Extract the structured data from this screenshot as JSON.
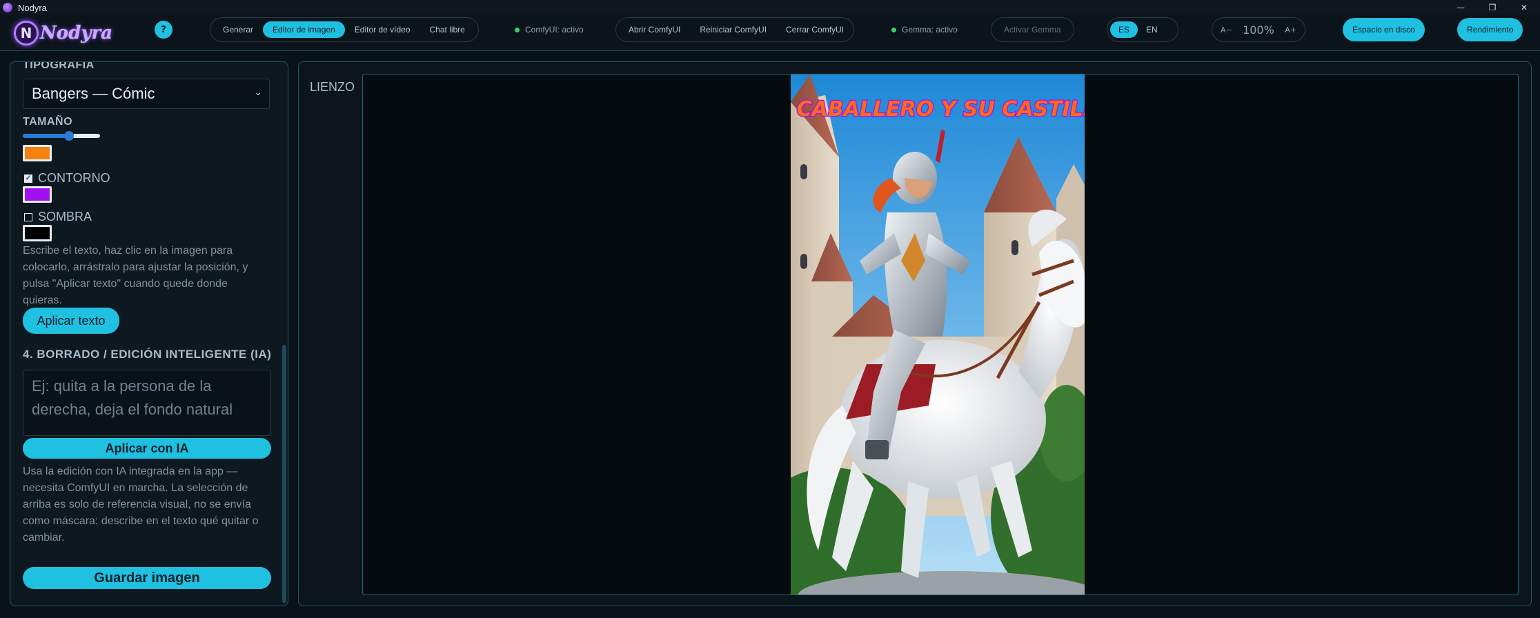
{
  "window": {
    "title": "Nodyra",
    "controls": [
      "—",
      "❐",
      "✕"
    ]
  },
  "header": {
    "logo_text": "Nodyra",
    "help_label": "?",
    "tabs": [
      {
        "label": "Generar",
        "active": false
      },
      {
        "label": "Editor de imagen",
        "active": true
      },
      {
        "label": "Editor de vídeo",
        "active": false
      },
      {
        "label": "Chat libre",
        "active": false
      }
    ],
    "comfy_status": "ComfyUI: activo",
    "comfy_actions": [
      "Abrir ComfyUI",
      "Reiniciar ComfyUI",
      "Cerrar ComfyUI"
    ],
    "gemma_status": "Gemma: activo",
    "activate_gemma": "Activar Gemma",
    "languages": [
      {
        "label": "ES",
        "active": true
      },
      {
        "label": "EN",
        "active": false
      }
    ],
    "zoom": {
      "minus": "A−",
      "value": "100%",
      "plus": "A+"
    },
    "disk_space": "Espacio en disco",
    "performance": "Rendimiento"
  },
  "left_panel": {
    "typography_label": "TIPOGRAFÍA",
    "font_select": "Bangers — Cómic",
    "size_label": "TAMAÑO",
    "size_value": 0.6,
    "fill_color": "#f4820f",
    "outline_label": "CONTORNO",
    "outline_checked": true,
    "outline_color": "#a311f0",
    "shadow_label": "SOMBRA",
    "shadow_checked": false,
    "shadow_color": "#000000",
    "text_help": "Escribe el texto, haz clic en la imagen para colocarlo, arrástralo para ajustar la posición, y pulsa \"Aplicar texto\" cuando quede donde quieras.",
    "apply_text": "Aplicar texto",
    "ai_section_label": "4. BORRADO / EDICIÓN INTELIGENTE (IA)",
    "ai_placeholder": "Ej: quita a la persona de la derecha, deja el fondo natural",
    "apply_ai": "Aplicar con IA",
    "ai_help": "Usa la edición con IA integrada en la app — necesita ComfyUI en marcha. La selección de arriba es solo de referencia visual, no se envía como máscara: describe en el texto qué quitar o cambiar.",
    "save_image": "Guardar imagen"
  },
  "canvas": {
    "label": "LIENZO",
    "image_title": "EL CABALLERO Y SU CASTILLO",
    "title_color": "#ff6a1a"
  }
}
